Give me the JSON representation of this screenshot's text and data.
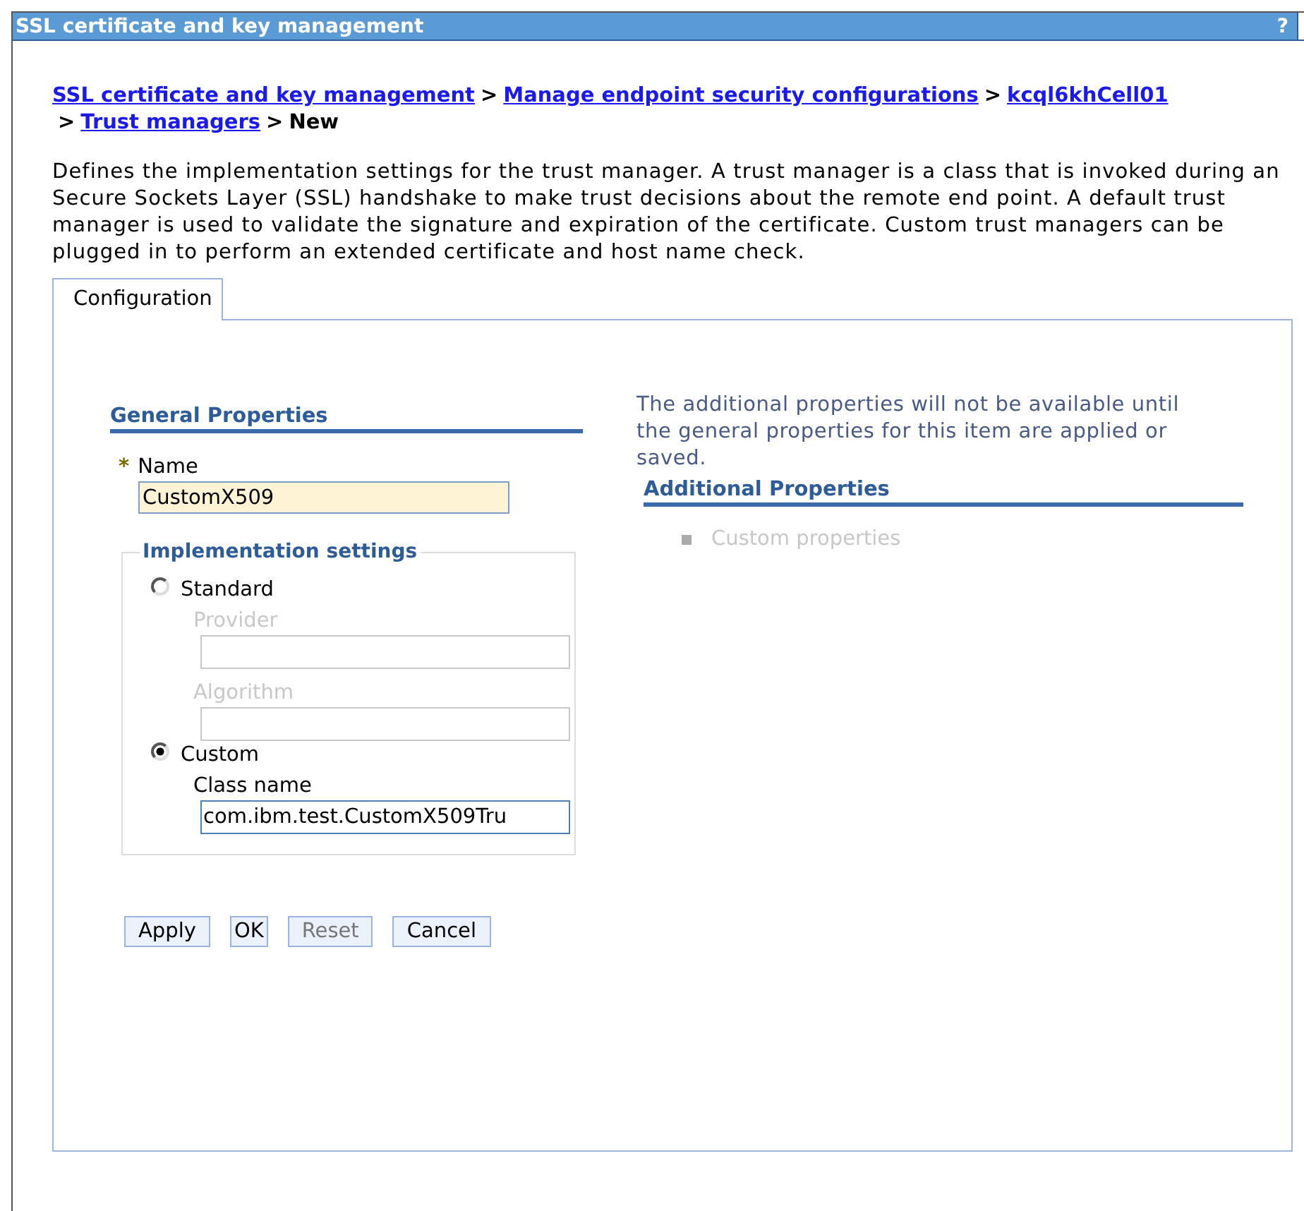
{
  "window": {
    "title": "SSL certificate and key management",
    "help_button": "?"
  },
  "breadcrumb": [
    {
      "kind": "link",
      "text": "SSL certificate and key management"
    },
    {
      "kind": "separator",
      "text": ">"
    },
    {
      "kind": "link",
      "text": "Manage endpoint security configurations"
    },
    {
      "kind": "separator",
      "text": ">"
    },
    {
      "kind": "link",
      "text": "kcql6khCell01"
    },
    {
      "kind": "break"
    },
    {
      "kind": "separator",
      "text": ">"
    },
    {
      "kind": "link",
      "text": "Trust managers"
    },
    {
      "kind": "separator",
      "text": ">"
    },
    {
      "kind": "current",
      "text": "New"
    }
  ],
  "description": "Defines the implementation settings for the trust manager. A trust manager is a class that is invoked during an Secure Sockets Layer (SSL) handshake to make trust decisions about the remote end point. A default trust manager is used to validate the signature and expiration of the certificate. Custom trust managers can be plugged in to perform an extended certificate and host name check.",
  "tabs": [
    {
      "label": "Configuration",
      "selected": true
    }
  ],
  "general_properties": {
    "heading": "General Properties",
    "name_field": {
      "required_mark": "*",
      "label": "Name",
      "value": "CustomX509"
    },
    "implementation_settings": {
      "legend": "Implementation settings",
      "options": [
        {
          "label": "Standard",
          "selected": false,
          "fields": [
            {
              "label": "Provider",
              "disabled": true
            },
            {
              "label": "Algorithm",
              "disabled": true
            }
          ]
        },
        {
          "label": "Custom",
          "selected": true,
          "fields": [
            {
              "label": "Class name",
              "value": "com.ibm.test.CustomX509Tru",
              "disabled": false
            }
          ]
        }
      ]
    }
  },
  "buttons": [
    {
      "label": "Apply",
      "disabled": false
    },
    {
      "label": "OK",
      "disabled": false
    },
    {
      "label": "Reset",
      "disabled": true
    },
    {
      "label": "Cancel",
      "disabled": false
    }
  ],
  "additional_properties": {
    "note": "The additional properties will not be available until the general properties for this item are applied or saved.",
    "heading": "Additional Properties",
    "items": [
      {
        "label": "Custom properties",
        "disabled": true
      }
    ]
  }
}
